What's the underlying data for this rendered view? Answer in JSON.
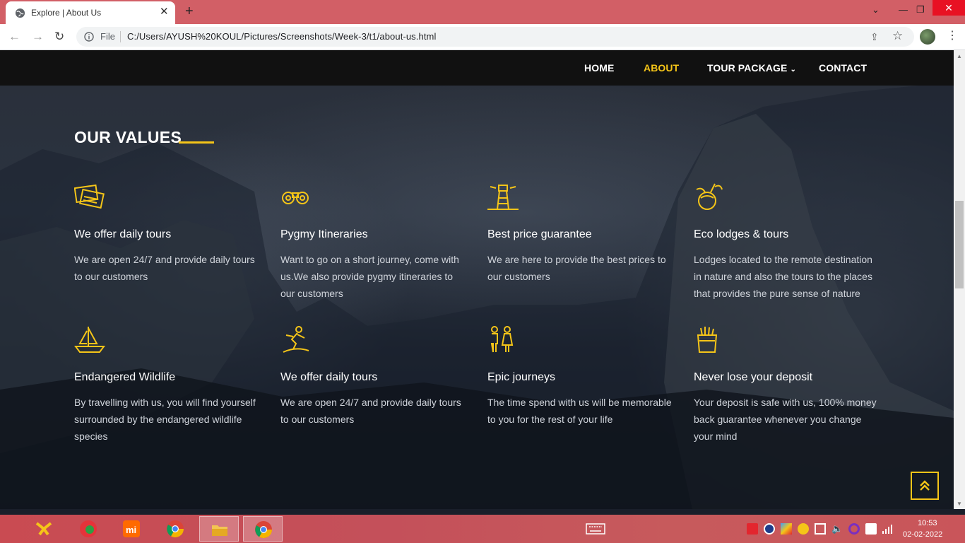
{
  "browser": {
    "tab_title": "Explore | About Us",
    "close_glyph": "✕",
    "new_tab_glyph": "+",
    "file_label": "File",
    "url": "C:/Users/AYUSH%20KOUL/Pictures/Screenshots/Week-3/t1/about-us.html",
    "back_glyph": "←",
    "forward_glyph": "→",
    "reload_glyph": "↻",
    "minimize_glyph": "—",
    "restore_glyph": "❐",
    "chevron_glyph": "⌄",
    "share_glyph": "⇪",
    "star_glyph": "☆",
    "menu_glyph": "⋮"
  },
  "nav": {
    "items": [
      {
        "label": "HOME"
      },
      {
        "label": "ABOUT",
        "active": true
      },
      {
        "label": "TOUR PACKAGE",
        "caret": "⌄"
      },
      {
        "label": "CONTACT"
      }
    ]
  },
  "section": {
    "title": "OUR VALUES"
  },
  "values": [
    {
      "icon": "tickets-icon",
      "title": "We offer daily tours",
      "text": "We are open 24/7 and provide daily tours to our customers"
    },
    {
      "icon": "binoculars-icon",
      "title": "Pygmy Itineraries",
      "text": "Want to go on a short journey, come with us.We also provide pygmy itineraries to our customers"
    },
    {
      "icon": "lighthouse-icon",
      "title": "Best price guarantee",
      "text": "We are here to provide the best prices to our customers"
    },
    {
      "icon": "coconut-drink-icon",
      "title": "Eco lodges & tours",
      "text": "Lodges located to the remote destination in nature and also the tours to the places that provides the pure sense of nature"
    },
    {
      "icon": "sailboat-icon",
      "title": "Endangered Wildlife",
      "text": "By travelling with us, you will find yourself surrounded by the endangered wildlife species"
    },
    {
      "icon": "surfer-icon",
      "title": "We offer daily tours",
      "text": "We are open 24/7 and provide daily tours to our customers"
    },
    {
      "icon": "couple-icon",
      "title": "Epic journeys",
      "text": "The time spend with us will be memorable to you for the rest of your life"
    },
    {
      "icon": "fries-icon",
      "title": "Never lose your deposit",
      "text": "Your deposit is safe with us, 100% money back guarantee whenever you change your mind"
    }
  ],
  "colors": {
    "accent": "#f5c518",
    "header_bg": "#111111",
    "tabbar_bg": "#d25f66"
  },
  "taskbar": {
    "time": "10:53",
    "date": "02-02-2022"
  }
}
